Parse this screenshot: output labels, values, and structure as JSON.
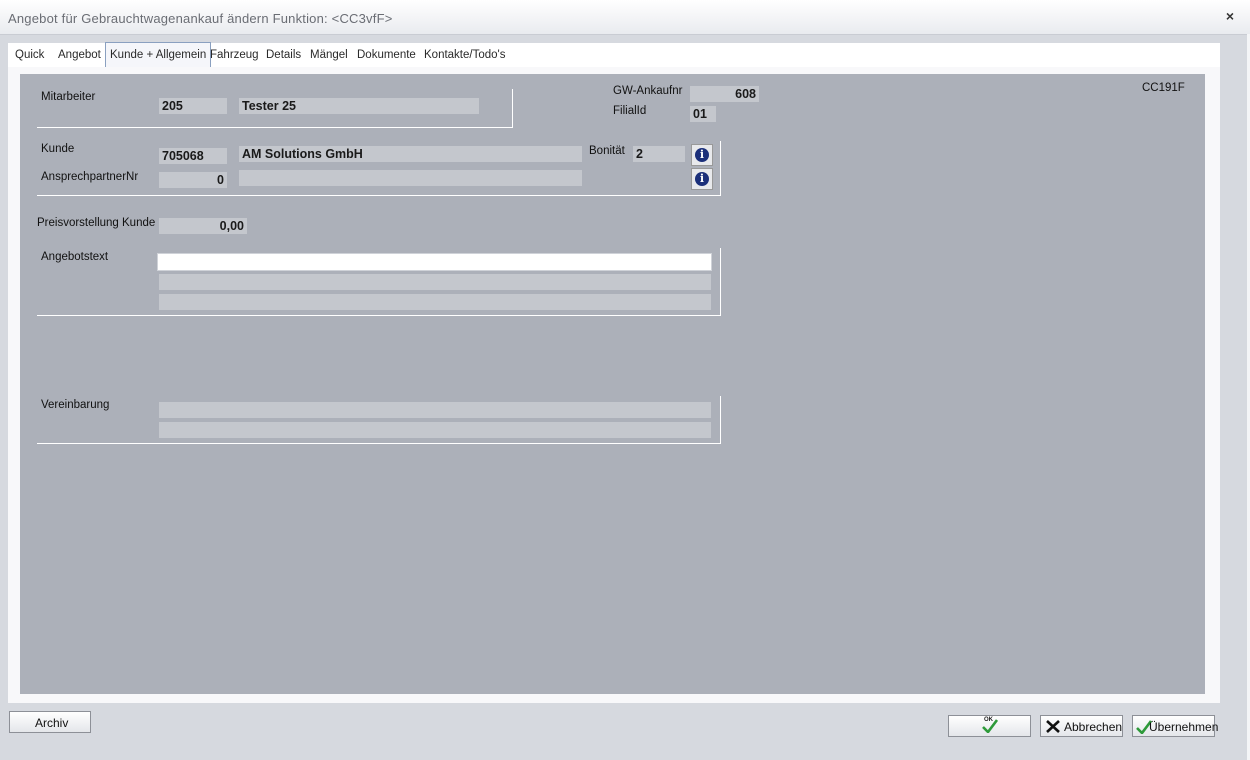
{
  "window": {
    "title": "Angebot für Gebrauchtwagenankauf ändern   Funktion: <CC3vfF>",
    "close_glyph": "×"
  },
  "tabs": [
    {
      "label": "Quick"
    },
    {
      "label": "Angebot"
    },
    {
      "label": "Kunde + Allgemein",
      "active": true
    },
    {
      "label": "Fahrzeug"
    },
    {
      "label": "Details"
    },
    {
      "label": "Mängel"
    },
    {
      "label": "Dokumente"
    },
    {
      "label": "Kontakte/Todo's"
    }
  ],
  "form": {
    "mitarbeiter": {
      "label": "Mitarbeiter",
      "nr": "205",
      "name": "Tester 25"
    },
    "gw_ankaufnr": {
      "label": "GW-Ankaufnr",
      "value": "608"
    },
    "filialid": {
      "label": "FilialId",
      "value": "01"
    },
    "code": "CC191F",
    "kunde": {
      "label": "Kunde",
      "nr": "705068",
      "name": "AM Solutions GmbH"
    },
    "bonitaet": {
      "label": "Bonität",
      "value": "2"
    },
    "ansprechpartner": {
      "label": "AnsprechpartnerNr",
      "nr": "0",
      "name": ""
    },
    "preisvorstellung": {
      "label": "Preisvorstellung Kunde",
      "value": "0,00"
    },
    "angebotstext": {
      "label": "Angebotstext",
      "lines": [
        "",
        "",
        ""
      ]
    },
    "vereinbarung": {
      "label": "Vereinbarung",
      "lines": [
        "",
        ""
      ]
    },
    "info_icon": "i"
  },
  "buttons": {
    "archiv": "Archiv",
    "ok": "OK",
    "abbrechen": "Abbrechen",
    "uebernehmen": "Übernehmen"
  },
  "colors": {
    "panel_bg": "#acb0b9",
    "field_bg": "#c4c7cd",
    "info_icon": "#1b2f7a",
    "ok_check": "#2e9a3a",
    "cancel_x": "#111111"
  }
}
